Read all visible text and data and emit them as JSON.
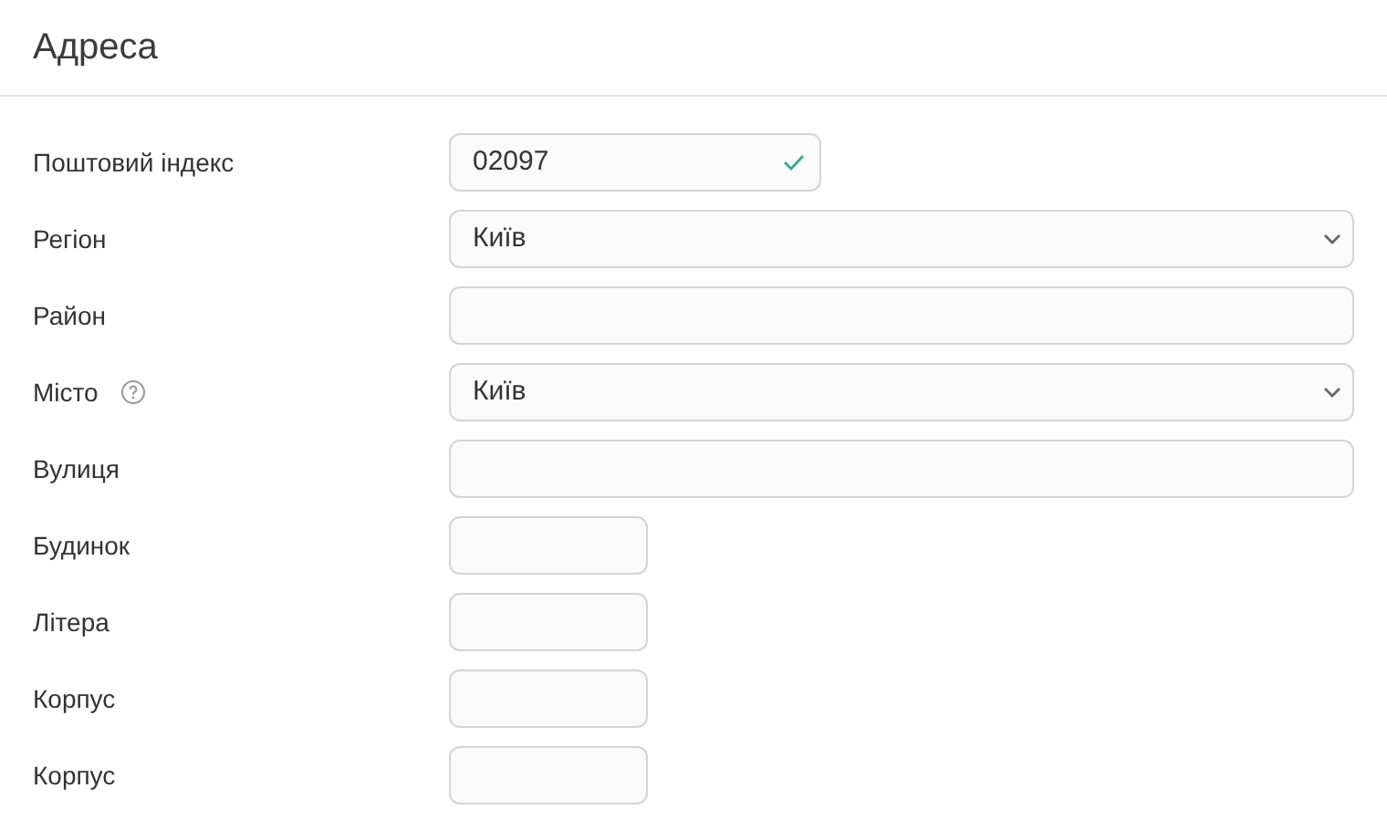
{
  "title": "Адреса",
  "fields": [
    {
      "label": "Поштовий індекс",
      "kind": "short-input",
      "value": "02097",
      "valid": true,
      "help": false
    },
    {
      "label": "Регіон",
      "kind": "wide-select",
      "value": "Київ",
      "help": false
    },
    {
      "label": "Район",
      "kind": "wide-input",
      "help": false
    },
    {
      "label": "Місто",
      "kind": "wide-select",
      "value": "Київ",
      "help": true
    },
    {
      "label": "Вулиця",
      "kind": "wide-input",
      "help": false
    },
    {
      "label": "Будинок",
      "kind": "tiny-input",
      "help": false
    },
    {
      "label": "Літера",
      "kind": "tiny-input",
      "help": false
    },
    {
      "label": "Корпус",
      "kind": "tiny-input",
      "help": false
    },
    {
      "label": "Корпус",
      "kind": "tiny-input",
      "help": false
    }
  ]
}
